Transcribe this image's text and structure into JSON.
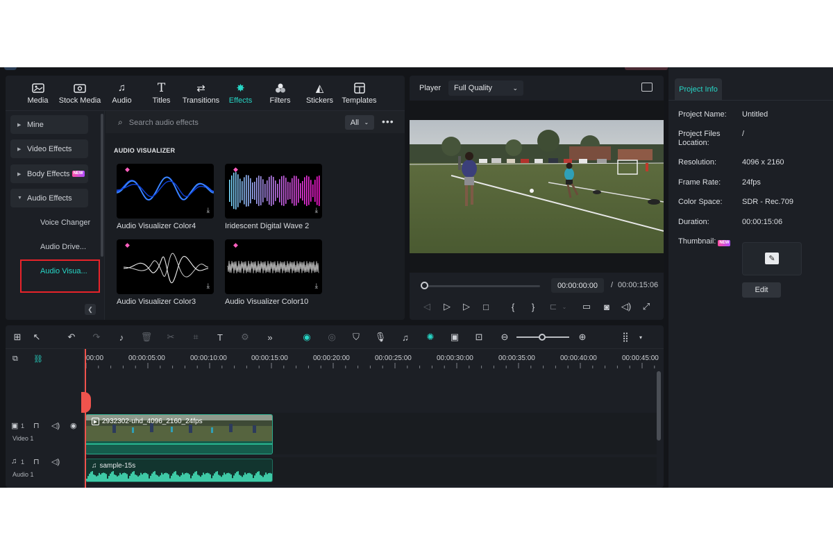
{
  "library": {
    "tabs": [
      {
        "label": "Media",
        "icon": "media-icon"
      },
      {
        "label": "Stock Media",
        "icon": "stock-media-icon"
      },
      {
        "label": "Audio",
        "icon": "music-note-icon"
      },
      {
        "label": "Titles",
        "icon": "text-t-icon"
      },
      {
        "label": "Transitions",
        "icon": "transitions-icon"
      },
      {
        "label": "Effects",
        "icon": "effects-sparkle-icon"
      },
      {
        "label": "Filters",
        "icon": "filters-icon"
      },
      {
        "label": "Stickers",
        "icon": "stickers-icon"
      },
      {
        "label": "Templates",
        "icon": "templates-icon"
      }
    ],
    "active_tab": "Effects",
    "sidebar": {
      "groups": [
        "Mine",
        "Video Effects",
        "Body Effects",
        "Audio Effects"
      ],
      "new_badge": "NEW",
      "sub_items": [
        "Voice Changer",
        "Audio Drive...",
        "Audio Visua..."
      ],
      "active_sub": "Audio Visua..."
    },
    "search": {
      "placeholder": "Search audio effects",
      "filter": "All"
    },
    "section_title": "AUDIO VISUALIZER",
    "cards": [
      {
        "label": "Audio Visualizer Color4",
        "premium": true
      },
      {
        "label": "Iridescent Digital Wave 2",
        "premium": true
      },
      {
        "label": "Audio Visualizer Color3",
        "premium": true
      },
      {
        "label": "Audio Visualizer Color10",
        "premium": true
      }
    ],
    "accent_color": "#27d6c6"
  },
  "player": {
    "label": "Player",
    "quality": "Full Quality",
    "current_time": "00:00:00:00",
    "separator": "/",
    "total_time": "00:00:15:06",
    "progress_fraction": 0.0
  },
  "project_info": {
    "tab": "Project Info",
    "rows": [
      {
        "key": "Project Name:",
        "value": "Untitled"
      },
      {
        "key": "Project Files Location:",
        "value": "/"
      },
      {
        "key": "Resolution:",
        "value": "4096 x 2160"
      },
      {
        "key": "Frame Rate:",
        "value": "24fps"
      },
      {
        "key": "Color Space:",
        "value": "SDR - Rec.709"
      },
      {
        "key": "Duration:",
        "value": "00:00:15:06"
      }
    ],
    "thumbnail_label": "Thumbnail:",
    "thumbnail_badge": "NEW",
    "edit_button": "Edit"
  },
  "timeline": {
    "ruler_labels": [
      "00:00",
      "00:00:05:00",
      "00:00:10:00",
      "00:00:15:00",
      "00:00:20:00",
      "00:00:25:00",
      "00:00:30:00",
      "00:00:35:00",
      "00:00:40:00",
      "00:00:45:00"
    ],
    "tracks": [
      {
        "name": "Video 1",
        "number": "1"
      },
      {
        "name": "Audio 1",
        "number": "1"
      }
    ],
    "video_clip": "2932302-uhd_4096_2160_24fps",
    "audio_clip": "sample-15s"
  }
}
